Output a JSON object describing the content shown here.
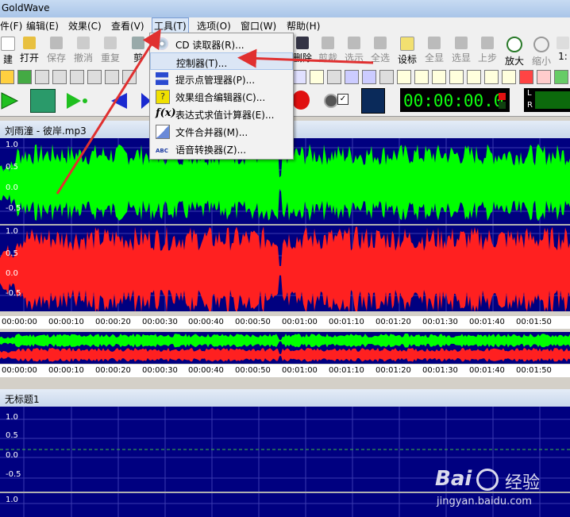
{
  "window": {
    "title": "GoldWave"
  },
  "menubar": {
    "items": [
      "件(F)",
      "编辑(E)",
      "效果(C)",
      "查看(V)",
      "工具(T)",
      "选项(O)",
      "窗口(W)",
      "帮助(H)"
    ]
  },
  "toolbar": {
    "buttons": [
      "建",
      "打开",
      "保存",
      "撤消",
      "重复",
      "剪",
      "删除",
      "剪裁",
      "选示",
      "全选",
      "设标",
      "全显",
      "选显",
      "上步",
      "放大",
      "缩小",
      "1:"
    ]
  },
  "transport": {
    "time_display": "00:00:00.0",
    "lr_top": "L",
    "lr_bottom": "R"
  },
  "tools_menu": {
    "items": [
      {
        "label": "CD 读取器(R)...",
        "icon": "cd-icon"
      },
      {
        "label": "控制器(T)...",
        "icon": "none",
        "highlighted": true
      },
      {
        "label": "提示点管理器(P)...",
        "icon": "cue-icon"
      },
      {
        "label": "效果组合编辑器(C)...",
        "icon": "effect-chain-icon"
      },
      {
        "label": "表达式求值计算器(E)...",
        "icon": "fx-icon"
      },
      {
        "label": "文件合并器(M)...",
        "icon": "merge-icon"
      },
      {
        "label": "语音转换器(Z)...",
        "icon": "abc-icon"
      }
    ]
  },
  "track1": {
    "title": "刘雨潼 - 彼岸.mp3",
    "y_labels": [
      "1.0",
      "0.5",
      "0.0",
      "-0.5",
      "1.0",
      "0.5",
      "0.0",
      "-0.5"
    ],
    "timeline": [
      "00:00:00",
      "00:00:10",
      "00:00:20",
      "00:00:30",
      "00:00:40",
      "00:00:50",
      "00:01:00",
      "00:01:10",
      "00:01:20",
      "00:01:30",
      "00:01:40",
      "00:01:50"
    ]
  },
  "overview": {
    "timeline": [
      "00:00:00",
      "00:00:10",
      "00:00:20",
      "00:00:30",
      "00:00:40",
      "00:00:50",
      "00:01:00",
      "00:01:10",
      "00:01:20",
      "00:01:30",
      "00:01:40",
      "00:01:50"
    ]
  },
  "track2": {
    "title": "无标题1",
    "y_labels": [
      "1.0",
      "0.5",
      "0.0",
      "-0.5",
      "1.0"
    ]
  },
  "watermark": {
    "brand": "Bai",
    "brand2": "经验",
    "url": "jingyan.baidu.com"
  },
  "colors": {
    "accent": "#e03030",
    "wave_left": "#00ff00",
    "wave_right": "#ff2020",
    "wave_bg": "#000080"
  }
}
